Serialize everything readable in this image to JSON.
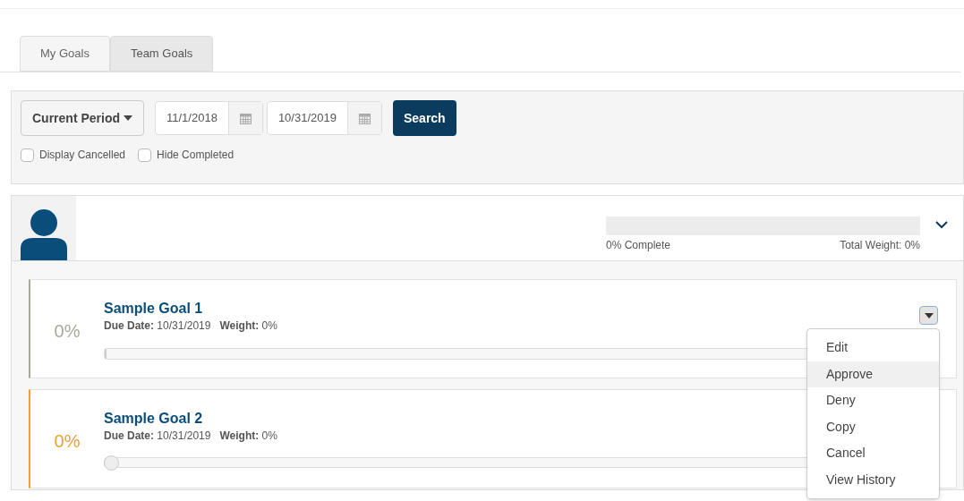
{
  "tabs": [
    {
      "label": "My Goals",
      "selected": false
    },
    {
      "label": "Team Goals",
      "selected": true
    }
  ],
  "filters": {
    "period": "Current Period",
    "start_date": "11/1/2018",
    "end_date": "10/31/2019",
    "search_button": "Search",
    "checkboxes": [
      {
        "label": "Display Cancelled",
        "checked": false
      },
      {
        "label": "Hide Completed",
        "checked": false
      }
    ]
  },
  "summary": {
    "level": 0,
    "complete": "0% Complete",
    "total_weight": "Total Weight: 0%",
    "expanded": true
  },
  "goals": [
    {
      "title": "Sample Goal 1",
      "percent": "0%",
      "due_label": "Due Date:",
      "due": "10/31/2019",
      "weight_label": "Weight:",
      "weight": "0%",
      "color": "#a8a89a",
      "kind": "bar",
      "level": 0,
      "menu_open": true
    },
    {
      "title": "Sample Goal 2",
      "percent": "0%",
      "due_label": "Due Date:",
      "due": "10/31/2019",
      "weight_label": "Weight:",
      "weight": "0%",
      "color": "#f0a030",
      "kind": "slider",
      "level": 0
    }
  ],
  "menu": [
    {
      "label": "Edit",
      "selected": false
    },
    {
      "label": "Approve",
      "selected": true
    },
    {
      "label": "Deny",
      "selected": false
    },
    {
      "label": "Copy",
      "selected": false
    },
    {
      "label": "Cancel",
      "selected": false
    },
    {
      "label": "View History",
      "selected": false
    }
  ]
}
